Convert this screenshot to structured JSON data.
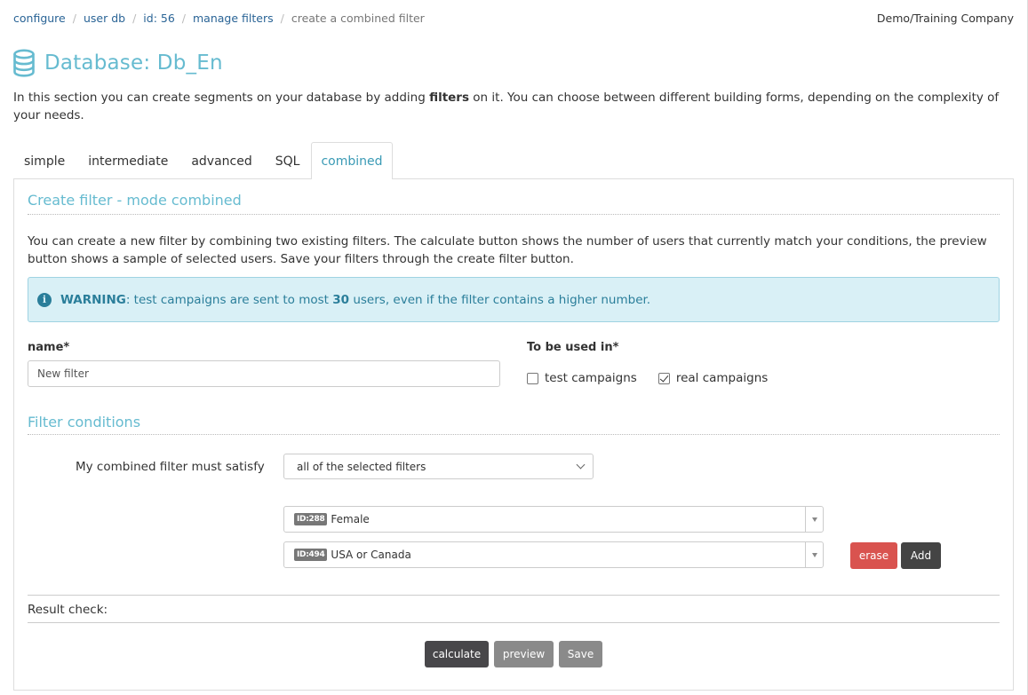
{
  "breadcrumb": [
    {
      "label": "configure",
      "link": true
    },
    {
      "label": "user db",
      "link": true
    },
    {
      "label": "id: 56",
      "link": true
    },
    {
      "label": "manage filters",
      "link": true
    },
    {
      "label": "create a combined filter",
      "link": false
    }
  ],
  "company": "Demo/Training Company",
  "page_title": "Database: Db_En",
  "intro": {
    "before": "In this section you can create segments on your database by adding ",
    "bold": "filters",
    "after": " on it. You can choose between different building forms, depending on the complexity of your needs."
  },
  "tabs": [
    {
      "label": "simple",
      "active": false
    },
    {
      "label": "intermediate",
      "active": false
    },
    {
      "label": "advanced",
      "active": false
    },
    {
      "label": "SQL",
      "active": false
    },
    {
      "label": "combined",
      "active": true
    }
  ],
  "panel": {
    "title": "Create filter - mode combined",
    "description": "You can create a new filter by combining two existing filters. The calculate button shows the number of users that currently match your conditions, the preview button shows a sample of selected users. Save your filters through the create filter button.",
    "warning": {
      "icon": "info-icon",
      "label": "WARNING",
      "text_before": ": test campaigns are sent to most ",
      "number": "30",
      "text_after": " users, even if the filter contains a higher number."
    },
    "name_label": "name*",
    "name_value": "New filter",
    "used_in_label": "To be used in*",
    "checkboxes": [
      {
        "label": "test campaigns",
        "checked": false
      },
      {
        "label": "real campaigns",
        "checked": true
      }
    ],
    "conditions_title": "Filter conditions",
    "satisfy_label": "My combined filter must satisfy",
    "satisfy_value": "all of the selected filters",
    "filters": [
      {
        "id_badge": "ID:288",
        "name": "Female"
      },
      {
        "id_badge": "ID:494",
        "name": "USA or Canada"
      }
    ],
    "erase_label": "erase",
    "add_label": "Add",
    "result_check_label": "Result check:",
    "calculate_label": "calculate",
    "preview_label": "preview",
    "save_label": "Save"
  }
}
